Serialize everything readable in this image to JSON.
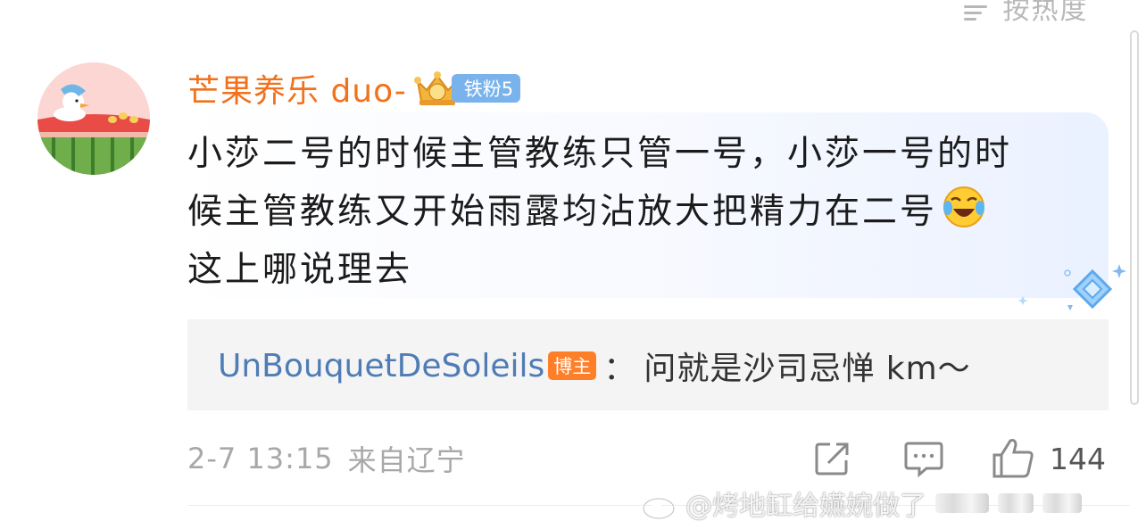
{
  "header": {
    "sort_label": "按热度",
    "sort_icon": "sort-lines-icon"
  },
  "comment": {
    "avatar_icon": "watermelon-duck-avatar",
    "username": "芒果养乐 duo-",
    "fan_badge": {
      "icon": "crown-icon",
      "level_text": "5",
      "label": "铁粉5"
    },
    "text_line_1": "小莎二号的时候主管教练只管一号，小莎一号的时",
    "text_line_2": "候主管教练又开始雨露均沾放大把精力在二号",
    "text_line_3": "这上哪说理去",
    "emoji": "laughing-crying-emoji",
    "reply": {
      "user": "UnBouquetDeSoleils",
      "host_tag": "博主",
      "separator": "：",
      "text": "问就是沙司忌惮 km～"
    },
    "meta": {
      "time": "2-7 13:15",
      "location": "来自辽宁"
    },
    "actions": {
      "share_icon": "share-icon",
      "comment_icon": "comment-icon",
      "like_icon": "thumbs-up-icon",
      "like_count": "144"
    }
  },
  "watermark": {
    "logo": "weibo-logo",
    "text": "@烤地缸给嬿婉做了"
  },
  "colors": {
    "username": "#f2711c",
    "reply_user": "#4f7cb5",
    "host_tag": "#ff7e28",
    "fan_badge": "#7ab3ec",
    "meta": "#a8a8a8"
  }
}
